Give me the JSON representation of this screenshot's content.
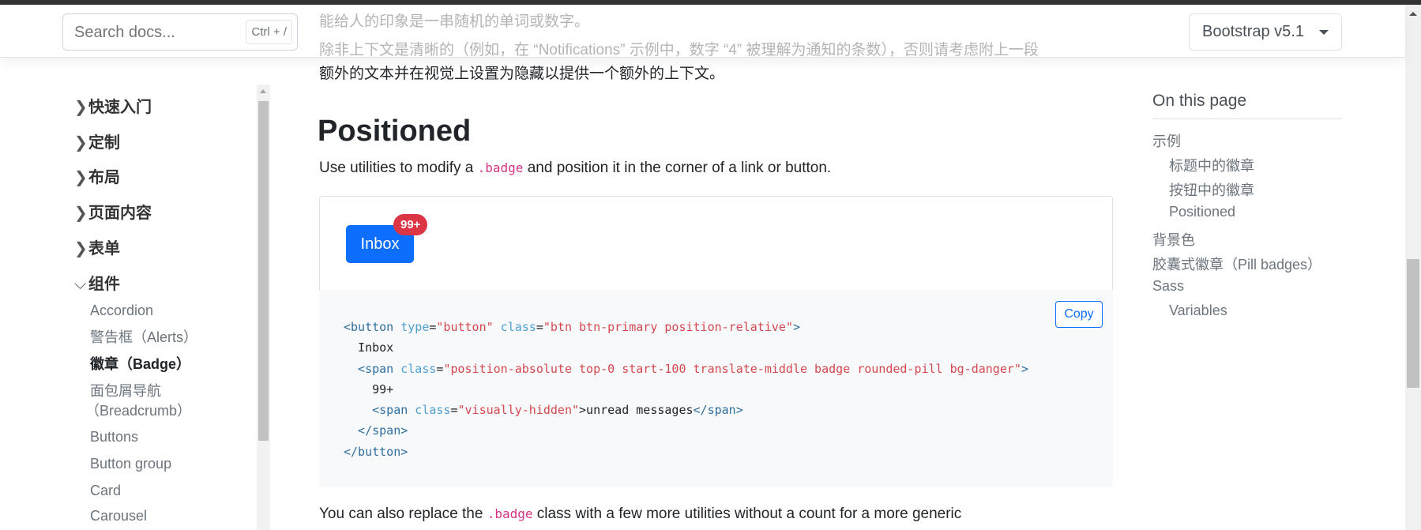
{
  "header": {
    "search_placeholder": "Search docs...",
    "search_shortcut": "Ctrl + /",
    "version": "Bootstrap v5.1"
  },
  "behind_header": {
    "line1": "能给人的印象是一串随机的单词或数字。",
    "line2": "除非上下文是清晰的（例如，在 “Notifications” 示例中，数字 “4” 被理解为通知的条数），否则请考虑附上一段",
    "line3": "额外的文本并在视觉上设置为隐藏以提供一个额外的上下文。"
  },
  "sidebar": {
    "groups": [
      {
        "label": "快速入门",
        "expanded": false
      },
      {
        "label": "定制",
        "expanded": false
      },
      {
        "label": "布局",
        "expanded": false
      },
      {
        "label": "页面内容",
        "expanded": false
      },
      {
        "label": "表单",
        "expanded": false
      },
      {
        "label": "组件",
        "expanded": true
      }
    ],
    "items": [
      {
        "label": "Accordion"
      },
      {
        "label": "警告框（Alerts）"
      },
      {
        "label": "徽章（Badge）",
        "active": true
      },
      {
        "label": "面包屑导航"
      },
      {
        "label": "（Breadcrumb）"
      },
      {
        "label": "Buttons"
      },
      {
        "label": "Button group"
      },
      {
        "label": "Card"
      },
      {
        "label": "Carousel"
      }
    ]
  },
  "main": {
    "heading": "Positioned",
    "lead_before": "Use utilities to modify a ",
    "lead_code": ".badge",
    "lead_after": " and position it in the corner of a link or button.",
    "example": {
      "button_label": "Inbox",
      "badge": "99+"
    },
    "copy_label": "Copy",
    "code": {
      "l1_tag": "<button",
      "l1_a1": " type",
      "l1_s1": "\"button\"",
      "l1_a2": " class",
      "l1_s2": "\"btn btn-primary position-relative\"",
      "l1_end": ">",
      "l2": "  Inbox",
      "l3_tag": "  <span",
      "l3_a": " class",
      "l3_s": "\"position-absolute top-0 start-100 translate-middle badge rounded-pill bg-danger\"",
      "l3_end": ">",
      "l4": "    99+",
      "l5_tag": "    <span",
      "l5_a": " class",
      "l5_s": "\"visually-hidden\"",
      "l5_text": ">unread messages",
      "l5_close": "</span>",
      "l6": "  </span>",
      "l7": "</button>"
    },
    "para_before": "You can also replace the ",
    "para_code": ".badge",
    "para_after": " class with a few more utilities without a count for a more generic"
  },
  "toc": {
    "title": "On this page",
    "items": [
      {
        "label": "示例",
        "level": 1
      },
      {
        "label": "标题中的徽章",
        "level": 2
      },
      {
        "label": "按钮中的徽章",
        "level": 2
      },
      {
        "label": "Positioned",
        "level": 2
      },
      {
        "label": "背景色",
        "level": 1
      },
      {
        "label": "胶囊式徽章（Pill badges）",
        "level": 1
      },
      {
        "label": "Sass",
        "level": 1
      },
      {
        "label": "Variables",
        "level": 2
      }
    ]
  },
  "colors": {
    "primary": "#0d6efd",
    "danger": "#dc3545",
    "code_bg": "#f8f9fa"
  }
}
